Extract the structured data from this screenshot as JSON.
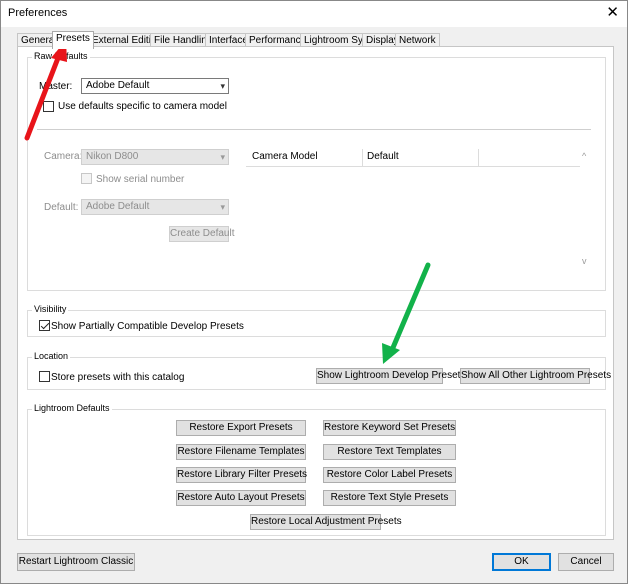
{
  "window": {
    "title": "Preferences"
  },
  "tabs": [
    "General",
    "Presets",
    "External Editing",
    "File Handling",
    "Interface",
    "Performance",
    "Lightroom Sync",
    "Display",
    "Network"
  ],
  "raw_defaults": {
    "group_title": "Raw Defaults",
    "master_label": "Master:",
    "master_value": "Adobe Default",
    "camera_specific_label": "Use defaults specific to camera model",
    "camera_label": "Camera:",
    "camera_value": "Nikon D800",
    "serial_label": "Show serial number",
    "default_label": "Default:",
    "default_value": "Adobe Default",
    "create_default_label": "Create Default",
    "table_headers": [
      "Camera Model",
      "Default",
      ""
    ]
  },
  "visibility": {
    "group_title": "Visibility",
    "show_partial_label": "Show Partially Compatible Develop Presets",
    "show_partial_checked": true
  },
  "location": {
    "group_title": "Location",
    "store_label": "Store presets with this catalog",
    "store_checked": false,
    "show_develop_label": "Show Lightroom Develop Presets",
    "show_other_label": "Show All Other Lightroom Presets"
  },
  "lightroom_defaults": {
    "group_title": "Lightroom Defaults",
    "buttons": [
      "Restore Export Presets",
      "Restore Keyword Set Presets",
      "Restore Filename Templates",
      "Restore Text Templates",
      "Restore Library Filter Presets",
      "Restore Color Label Presets",
      "Restore Auto Layout Presets",
      "Restore Text Style Presets",
      "Restore Local Adjustment Presets"
    ]
  },
  "footer": {
    "restart_label": "Restart Lightroom Classic",
    "ok_label": "OK",
    "cancel_label": "Cancel"
  },
  "annotations": {
    "red_arrow_color": "#e8141a",
    "green_arrow_color": "#12b24a"
  },
  "icons": {
    "close": "close-icon",
    "dropdown": "chevron-down-icon",
    "scroll_up": "scroll-up-icon",
    "scroll_down": "scroll-down-icon"
  }
}
